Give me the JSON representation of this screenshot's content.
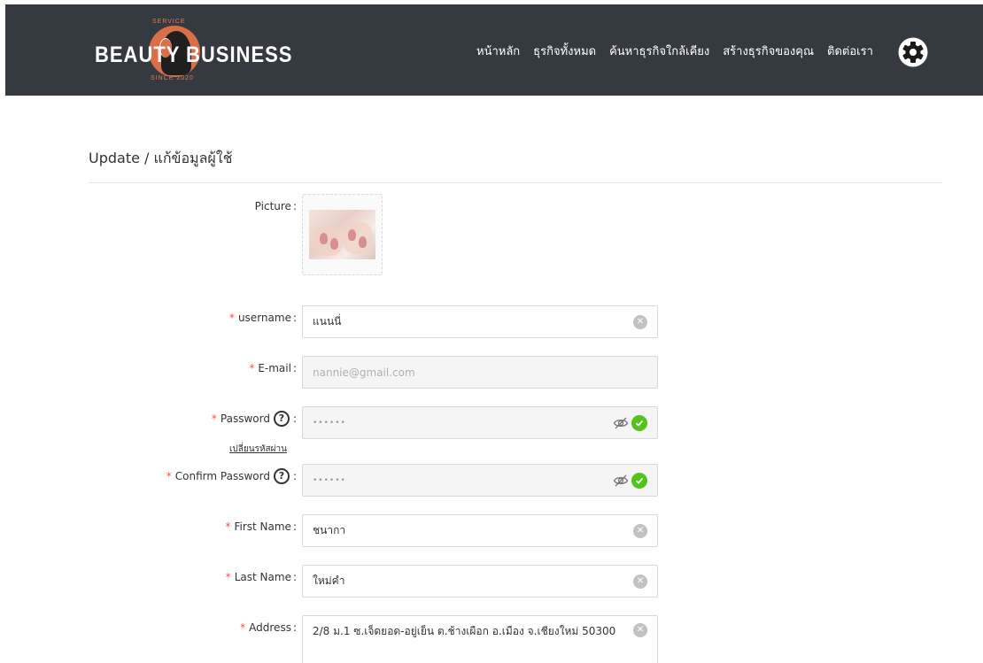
{
  "header": {
    "logo": {
      "service": "SERVICE",
      "word_left": "BEAUTY",
      "word_right": "BUSINESS",
      "since": "SINCE 2020"
    },
    "nav": [
      {
        "label": "หน้าหลัก"
      },
      {
        "label": "ธุรกิจทั้งหมด"
      },
      {
        "label": "ค้นหาธุรกิจใกล้เคียง"
      },
      {
        "label": "สร้างธุรกิจของคุณ"
      },
      {
        "label": "ติดต่อเรา"
      }
    ],
    "settings_icon": "gear-icon"
  },
  "page": {
    "title": "Update / แก้ข้อมูลผู้ใช้"
  },
  "form": {
    "picture_label": "Picture",
    "username": {
      "label": "username",
      "value": "แนนนี่"
    },
    "email": {
      "label": "E-mail",
      "value": "nannie@gmail.com"
    },
    "password": {
      "label": "Password",
      "value": "••••••",
      "change_link": "เปลี่ยนรหัสผ่าน"
    },
    "confirm_password": {
      "label": "Confirm Password",
      "value": "••••••"
    },
    "first_name": {
      "label": "First Name",
      "value": "ชนากา"
    },
    "last_name": {
      "label": "Last Name",
      "value": "ใหม่คำ"
    },
    "address": {
      "label": "Address",
      "value": "2/8 ม.1 ซ.เจ็ดยอด-อยู่เย็น ต.ช้างเผือก อ.เมือง จ.เชียงใหม่ 50300"
    }
  },
  "colors": {
    "header_bg": "#343a40",
    "accent": "#d96e47",
    "required": "#ff4d4f",
    "success": "#52c41a"
  }
}
